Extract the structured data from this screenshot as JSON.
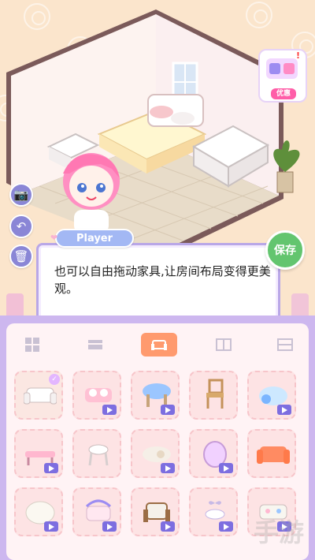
{
  "hud": {
    "save_label": "保存",
    "promo_label": "优惠",
    "alert_mark": "!"
  },
  "dialog": {
    "speaker": "Player",
    "text": "也可以自由拖动家具,让房间布局变得更美观。"
  },
  "panel": {
    "tabs": [
      "all",
      "bed",
      "sofa",
      "cabinet",
      "shelf"
    ],
    "active_tab": "sofa"
  },
  "items": [
    {
      "kind": "white-sofa",
      "selected": true
    },
    {
      "kind": "pink-lace-sofa",
      "video": true
    },
    {
      "kind": "blue-cushion-table",
      "video": true
    },
    {
      "kind": "wooden-chair",
      "video": false
    },
    {
      "kind": "blue-teddy-chair",
      "video": true
    },
    {
      "kind": "pink-bench",
      "video": true
    },
    {
      "kind": "vanity-stool",
      "video": false
    },
    {
      "kind": "cat-rug",
      "video": true
    },
    {
      "kind": "egg-chair",
      "video": true
    },
    {
      "kind": "orange-sofa",
      "video": false
    },
    {
      "kind": "white-pouf",
      "video": true
    },
    {
      "kind": "canopy-sofa",
      "video": true
    },
    {
      "kind": "wood-armchair",
      "video": true
    },
    {
      "kind": "bow-stool",
      "video": true
    },
    {
      "kind": "floral-sofa",
      "video": true
    }
  ],
  "icons": {
    "camera": "camera-icon",
    "undo": "undo-icon",
    "trash": "trash-icon"
  },
  "colors": {
    "save": "#63c56f",
    "active_tab": "#ff9a6e",
    "panel": "#cdb7ef",
    "side_button": "#8a86d6"
  }
}
